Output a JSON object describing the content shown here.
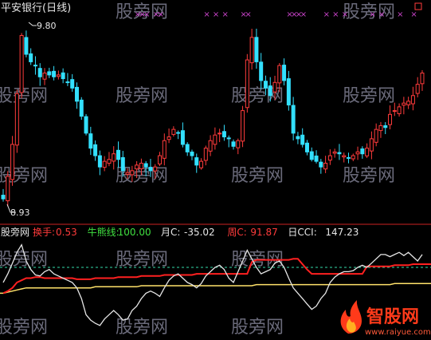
{
  "colors": {
    "background": "#000000",
    "up": "#ff3b3b",
    "down": "#33e0ff",
    "marker": "#cc44cc",
    "white_line": "#e6e6e6",
    "red_line": "#ff2020",
    "yellow_line": "#ffe26a",
    "dashed": "#33ddaa",
    "divider": "#cc2222",
    "watermark": "#6a6a7a"
  },
  "header": {
    "title": "平安银行(日线)"
  },
  "watermarks": {
    "text": "股旁网",
    "site_text": "智股网",
    "site_url": "www.raiyue.com"
  },
  "price_panel": {
    "high_label": "9.80",
    "low_label": "8.93",
    "price_range": [
      8.85,
      9.87
    ],
    "marker_symbol": "×"
  },
  "indicator_panel": {
    "label": "股旁网",
    "items": [
      {
        "name": "换手:",
        "value": "0.53",
        "name_color": "#ff3b3b",
        "value_color": "#ff3b3b"
      },
      {
        "name": "牛熊线:",
        "value": "100.00",
        "name_color": "#40e040",
        "value_color": "#40e040"
      },
      {
        "name": "月C:",
        "value": "-35.02",
        "name_color": "#e6e6e6",
        "value_color": "#e6e6e6"
      },
      {
        "name": "周C:",
        "value": "91.87",
        "name_color": "#ff3b3b",
        "value_color": "#ff3b3b"
      },
      {
        "name": "日CCI:",
        "value": "147.23",
        "name_color": "#e6e6e6",
        "value_color": "#e6e6e6"
      }
    ]
  },
  "chart_data": {
    "type": "candlestick",
    "title": "平安银行(日线)",
    "candles_close": [
      8.93,
      9.05,
      9.22,
      9.49,
      9.8,
      9.7,
      9.66,
      9.64,
      9.58,
      9.6,
      9.59,
      9.58,
      9.59,
      9.57,
      9.55,
      9.52,
      9.45,
      9.37,
      9.28,
      9.2,
      9.16,
      9.1,
      9.13,
      9.14,
      9.17,
      9.14,
      9.08,
      9.07,
      9.08,
      9.11,
      9.12,
      9.1,
      9.08,
      9.1,
      9.16,
      9.24,
      9.26,
      9.3,
      9.28,
      9.22,
      9.18,
      9.16,
      9.11,
      9.13,
      9.2,
      9.24,
      9.27,
      9.28,
      9.26,
      9.25,
      9.21,
      9.24,
      9.4,
      9.67,
      9.79,
      9.66,
      9.56,
      9.52,
      9.48,
      9.55,
      9.64,
      9.56,
      9.43,
      9.28,
      9.25,
      9.22,
      9.18,
      9.14,
      9.13,
      9.1,
      9.12,
      9.16,
      9.18,
      9.17,
      9.16,
      9.15,
      9.16,
      9.18,
      9.17,
      9.2,
      9.25,
      9.3,
      9.32,
      9.31,
      9.38,
      9.4,
      9.42,
      9.44,
      9.45,
      9.48,
      9.54,
      9.6
    ],
    "weekly_c": [
      0,
      2,
      5,
      10,
      12,
      14,
      14,
      15,
      15,
      14,
      14,
      14,
      14,
      14,
      14,
      14,
      13,
      13,
      13,
      13,
      14,
      14,
      14,
      14,
      14,
      15,
      15,
      15,
      15,
      15,
      16,
      16,
      16,
      16,
      16,
      17,
      17,
      17,
      17,
      17,
      17,
      17,
      18,
      18,
      18,
      18,
      18,
      18,
      18,
      18,
      18,
      18,
      18,
      18,
      29,
      31,
      31,
      31,
      31,
      31,
      31,
      31,
      31,
      32,
      32,
      27,
      22,
      18,
      18,
      18,
      18,
      18,
      18,
      18,
      18,
      18,
      18,
      18,
      18,
      25,
      25,
      25,
      25,
      25,
      25,
      26,
      26,
      26,
      26,
      27,
      27,
      27
    ],
    "monthly_c": [
      0,
      1,
      2,
      3,
      4,
      5,
      5,
      5,
      5,
      5,
      5,
      5,
      5,
      5,
      5,
      5,
      5,
      5,
      5,
      5,
      6,
      6,
      6,
      6,
      6,
      6,
      6,
      6,
      6,
      6,
      7,
      7,
      7,
      7,
      7,
      7,
      7,
      7,
      7,
      7,
      7,
      7,
      7,
      7,
      7,
      7,
      7,
      7,
      7,
      7,
      7,
      7,
      7,
      7,
      7,
      8,
      8,
      8,
      8,
      8,
      8,
      8,
      8,
      8,
      8,
      8,
      8,
      8,
      8,
      8,
      8,
      8,
      8,
      8,
      8,
      8,
      8,
      8,
      8,
      8,
      8,
      8,
      8,
      8,
      8,
      9,
      9,
      9,
      9,
      9,
      9,
      9
    ],
    "daily_cci": [
      10,
      18,
      28,
      38,
      45,
      30,
      22,
      17,
      16,
      20,
      22,
      18,
      16,
      14,
      12,
      10,
      5,
      -5,
      -20,
      -25,
      -28,
      -30,
      -24,
      -20,
      -16,
      -20,
      -25,
      -24,
      -16,
      -12,
      -5,
      0,
      2,
      0,
      -3,
      5,
      12,
      16,
      18,
      14,
      10,
      8,
      5,
      9,
      16,
      20,
      24,
      26,
      22,
      14,
      10,
      20,
      30,
      40,
      32,
      24,
      18,
      20,
      22,
      28,
      30,
      24,
      14,
      5,
      0,
      -5,
      -10,
      -15,
      -12,
      -5,
      0,
      10,
      15,
      18,
      20,
      20,
      21,
      24,
      26,
      24,
      28,
      32,
      36,
      36,
      34,
      36,
      38,
      35,
      38,
      34,
      30,
      36
    ],
    "dashed_level": 24,
    "indicator_range": [
      -42,
      50
    ]
  }
}
